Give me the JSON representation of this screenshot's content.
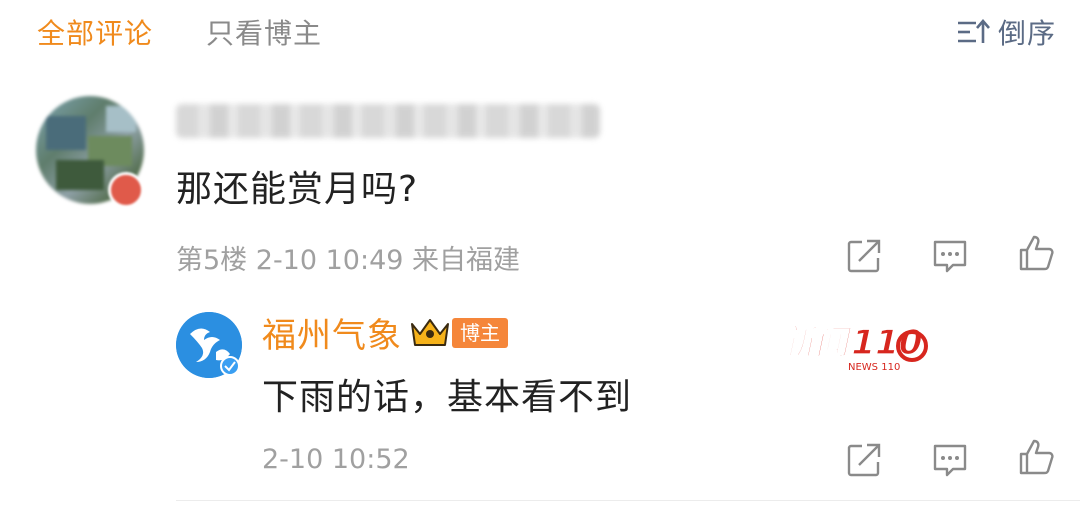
{
  "header": {
    "tab_all": "全部评论",
    "tab_blogger": "只看博主",
    "sort_label": "倒序",
    "sort_icon": "sort-desc-icon",
    "active_color": "#f08a1c"
  },
  "comment": {
    "text": "那还能赏月吗?",
    "meta": "第5楼 2-10 10:49 来自福建",
    "actions": [
      "share-icon",
      "comment-icon",
      "like-icon"
    ]
  },
  "reply": {
    "author": "福州气象",
    "badge": "博主",
    "text": "下雨的话，基本看不到",
    "meta": "2-10 10:52",
    "actions": [
      "share-icon",
      "comment-icon",
      "like-icon"
    ],
    "name_color": "#f08a1c",
    "badge_color": "#f5863a"
  },
  "watermark": {
    "text": "新闻110",
    "small": "NEWS 110"
  }
}
